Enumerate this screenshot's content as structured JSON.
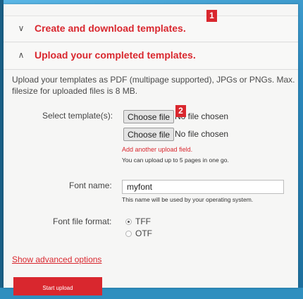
{
  "accordion": {
    "create_title": "Create and download templates.",
    "upload_title": "Upload your completed templates."
  },
  "badges": {
    "one": "1",
    "two": "2"
  },
  "intro_text": "Upload your templates as PDF (multipage supported), JPGs or PNGs. Max. filesize for uploaded files is 8 MB.",
  "templates": {
    "label": "Select template(s):",
    "files": [
      {
        "button": "Choose file",
        "status": "No file chosen"
      },
      {
        "button": "Choose file",
        "status": "No file chosen"
      }
    ],
    "add_another": "Add another upload field.",
    "limit_hint": "You can upload up to 5 pages in one go."
  },
  "font_name": {
    "label": "Font name:",
    "value": "myfont",
    "hint": "This name will be used by your operating system."
  },
  "font_format": {
    "label": "Font file format:",
    "options": [
      "TFF",
      "OTF"
    ],
    "selected": "TFF"
  },
  "advanced_link": "Show advanced options",
  "start_button": "Start upload"
}
